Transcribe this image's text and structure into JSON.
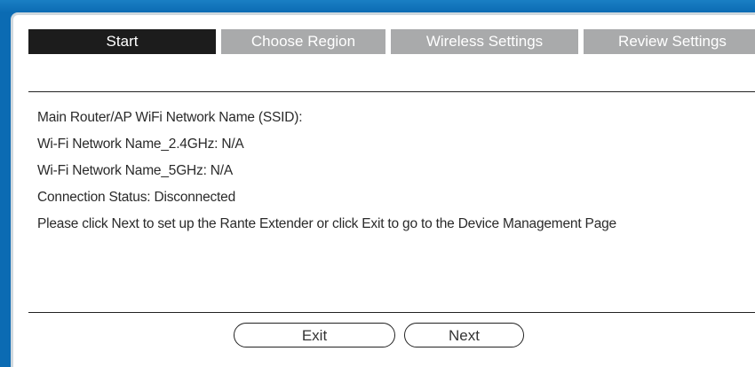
{
  "wizard": {
    "tabs": [
      {
        "label": "Start",
        "active": true
      },
      {
        "label": "Choose Region",
        "active": false
      },
      {
        "label": "Wireless Settings",
        "active": false
      },
      {
        "label": "Review Settings",
        "active": false
      }
    ]
  },
  "info": {
    "ssid_line": "Main Router/AP WiFi Network Name (SSID):",
    "name_24_line": "Wi-Fi Network Name_2.4GHz: N/A",
    "name_5_line": "Wi-Fi Network Name_5GHz: N/A",
    "status_line": "Connection Status: Disconnected",
    "instruction_line": "Please click Next to set up the Rante Extender or click Exit to go to the Device Management Page"
  },
  "buttons": {
    "exit_label": "Exit",
    "next_label": "Next"
  },
  "colors": {
    "frame_blue": "#0b6bb3",
    "tab_active": "#1c1c1c",
    "tab_inactive": "#a9aaab"
  }
}
